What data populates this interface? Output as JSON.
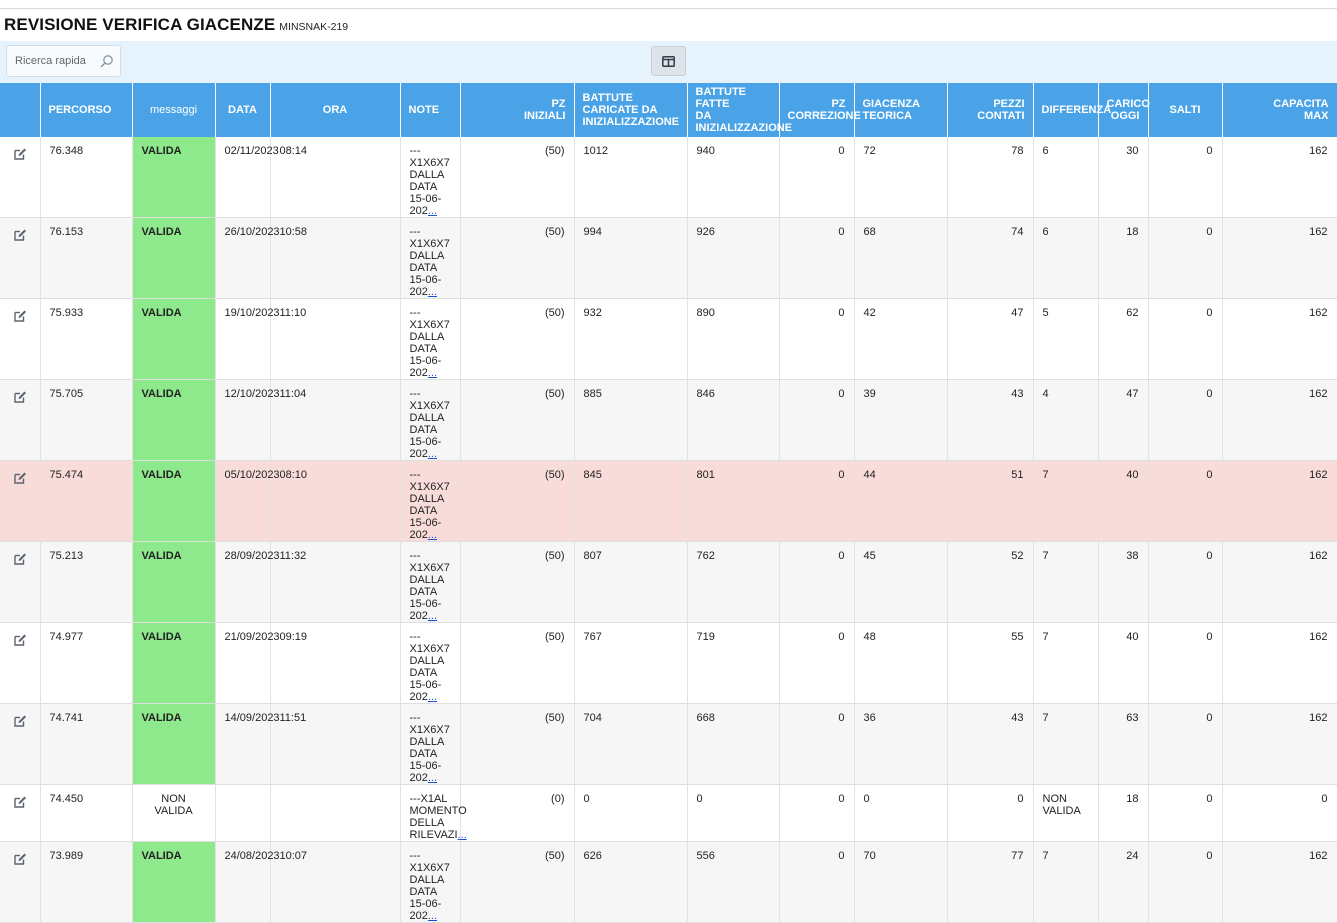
{
  "header": {
    "title": "REVISIONE VERIFICA GIACENZE",
    "code": "MINSNAK-219"
  },
  "toolbar": {
    "search_placeholder": "Ricerca rapida",
    "search_icon": "search-icon",
    "columns_icon": "columns-icon"
  },
  "colors": {
    "header_bg": "#4aa3e6",
    "toolbar_bg": "#e6f3fd",
    "valid_bg": "#8ee88c",
    "highlight_row": "#f7dcda",
    "link": "#1a4fd6"
  },
  "table": {
    "columns": {
      "percorso": "PERCORSO",
      "messaggi": "messaggi",
      "data": "DATA",
      "ora": "ORA",
      "note": "NOTE",
      "pz_iniziali_1": "PZ",
      "pz_iniziali_2": "INIZIALI",
      "battute_caricate_1": "BATTUTE",
      "battute_caricate_2": "CARICATE DA",
      "battute_caricate_3": "INIZIALIZZAZIONE",
      "battute_fatte_1": "BATTUTE FATTE",
      "battute_fatte_2": "DA",
      "battute_fatte_3": "INIZIALIZZAZIONE",
      "pz_correzione_1": "PZ",
      "pz_correzione_2": "CORREZIONE",
      "giacenza_1": "GIACENZA",
      "giacenza_2": "TEORICA",
      "pezzi_contati_1": "PEZZI",
      "pezzi_contati_2": "CONTATI",
      "differenza": "DIFFERENZA",
      "carico_1": "CARICO",
      "carico_2": "OGGI",
      "salti": "SALTI",
      "capacita_1": "CAPACITA",
      "capacita_2": "MAX",
      "note2": "NOTE"
    },
    "more_link": "...",
    "rows": [
      {
        "percorso": "76.348",
        "messaggi": "VALIDA",
        "data": "02/11/2023",
        "ora": "08:14",
        "note1": "---X1X6X7 DALLA",
        "note2": "DATA 15-06-202",
        "pz_iniziali": "(50)",
        "battute_caricate": "1012",
        "battute_fatte": "940",
        "pz_correzione": "0",
        "giacenza": "72",
        "pezzi_contati": "78",
        "differenza": "6",
        "carico": "30",
        "salti": "0",
        "capacita": "162",
        "note_extra": ""
      },
      {
        "percorso": "76.153",
        "messaggi": "VALIDA",
        "data": "26/10/2023",
        "ora": "10:58",
        "note1": "---X1X6X7 DALLA",
        "note2": "DATA 15-06-202",
        "pz_iniziali": "(50)",
        "battute_caricate": "994",
        "battute_fatte": "926",
        "pz_correzione": "0",
        "giacenza": "68",
        "pezzi_contati": "74",
        "differenza": "6",
        "carico": "18",
        "salti": "0",
        "capacita": "162",
        "note_extra": ""
      },
      {
        "percorso": "75.933",
        "messaggi": "VALIDA",
        "data": "19/10/2023",
        "ora": "11:10",
        "note1": "---X1X6X7 DALLA",
        "note2": "DATA 15-06-202",
        "pz_iniziali": "(50)",
        "battute_caricate": "932",
        "battute_fatte": "890",
        "pz_correzione": "0",
        "giacenza": "42",
        "pezzi_contati": "47",
        "differenza": "5",
        "carico": "62",
        "salti": "0",
        "capacita": "162",
        "note_extra": ""
      },
      {
        "percorso": "75.705",
        "messaggi": "VALIDA",
        "data": "12/10/2023",
        "ora": "11:04",
        "note1": "---X1X6X7 DALLA",
        "note2": "DATA 15-06-202",
        "pz_iniziali": "(50)",
        "battute_caricate": "885",
        "battute_fatte": "846",
        "pz_correzione": "0",
        "giacenza": "39",
        "pezzi_contati": "43",
        "differenza": "4",
        "carico": "47",
        "salti": "0",
        "capacita": "162",
        "note_extra": ""
      },
      {
        "percorso": "75.474",
        "messaggi": "VALIDA",
        "data": "05/10/2023",
        "ora": "08:10",
        "note1": "---X1X6X7 DALLA",
        "note2": "DATA 15-06-202",
        "pz_iniziali": "(50)",
        "battute_caricate": "845",
        "battute_fatte": "801",
        "pz_correzione": "0",
        "giacenza": "44",
        "pezzi_contati": "51",
        "differenza": "7",
        "carico": "40",
        "salti": "0",
        "capacita": "162",
        "note_extra": ""
      },
      {
        "percorso": "75.213",
        "messaggi": "VALIDA",
        "data": "28/09/2023",
        "ora": "11:32",
        "note1": "---X1X6X7 DALLA",
        "note2": "DATA 15-06-202",
        "pz_iniziali": "(50)",
        "battute_caricate": "807",
        "battute_fatte": "762",
        "pz_correzione": "0",
        "giacenza": "45",
        "pezzi_contati": "52",
        "differenza": "7",
        "carico": "38",
        "salti": "0",
        "capacita": "162",
        "note_extra": ""
      },
      {
        "percorso": "74.977",
        "messaggi": "VALIDA",
        "data": "21/09/2023",
        "ora": "09:19",
        "note1": "---X1X6X7 DALLA",
        "note2": "DATA 15-06-202",
        "pz_iniziali": "(50)",
        "battute_caricate": "767",
        "battute_fatte": "719",
        "pz_correzione": "0",
        "giacenza": "48",
        "pezzi_contati": "55",
        "differenza": "7",
        "carico": "40",
        "salti": "0",
        "capacita": "162",
        "note_extra": ""
      },
      {
        "percorso": "74.741",
        "messaggi": "VALIDA",
        "data": "14/09/2023",
        "ora": "11:51",
        "note1": "---X1X6X7 DALLA",
        "note2": "DATA 15-06-202",
        "pz_iniziali": "(50)",
        "battute_caricate": "704",
        "battute_fatte": "668",
        "pz_correzione": "0",
        "giacenza": "36",
        "pezzi_contati": "43",
        "differenza": "7",
        "carico": "63",
        "salti": "0",
        "capacita": "162",
        "note_extra": ""
      },
      {
        "percorso": "74.450",
        "messaggi": "NON VALIDA",
        "data": "",
        "ora": "",
        "note1": "---X1AL MOMENTO",
        "note2": "DELLA RILEVAZI",
        "pz_iniziali": "(0)",
        "battute_caricate": "0",
        "battute_fatte": "0",
        "pz_correzione": "0",
        "giacenza": "0",
        "pezzi_contati": "0",
        "differenza": "NON VALIDA",
        "carico": "18",
        "salti": "0",
        "capacita": "0",
        "note_extra": ""
      },
      {
        "percorso": "73.989",
        "messaggi": "VALIDA",
        "data": "24/08/2023",
        "ora": "10:07",
        "note1": "---X1X6X7 DALLA",
        "note2": "DATA 15-06-202",
        "pz_iniziali": "(50)",
        "battute_caricate": "626",
        "battute_fatte": "556",
        "pz_correzione": "0",
        "giacenza": "70",
        "pezzi_contati": "77",
        "differenza": "7",
        "carico": "24",
        "salti": "0",
        "capacita": "162",
        "note_extra": ""
      }
    ]
  }
}
